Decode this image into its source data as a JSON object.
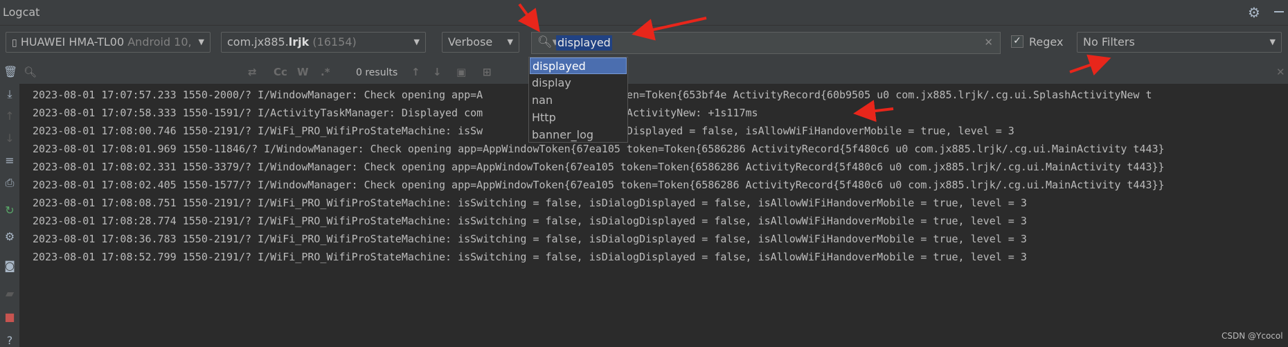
{
  "window": {
    "title": "Logcat"
  },
  "toolbar": {
    "device": {
      "name": "HUAWEI HMA-TL00",
      "version": "Android 10,"
    },
    "process": {
      "prefix": "com.jx885.",
      "bold": "lrjk",
      "pid": "(16154)"
    },
    "level": "Verbose",
    "search_value": "displayed",
    "regex": {
      "label": "Regex",
      "checked": true,
      "check_glyph": "✓"
    },
    "filter": "No Filters"
  },
  "secondary": {
    "results": "0 results",
    "cc_label": "Cc",
    "w_label": "W",
    "star_label": ".*"
  },
  "dropdown": {
    "items": [
      "displayed",
      "display",
      "nan",
      "Http",
      "banner_log"
    ],
    "selected_index": 0
  },
  "log_lines": [
    "2023-08-01 17:07:57.233 1550-2000/? I/WindowManager: Check opening app=A            638ae87 token=Token{653bf4e ActivityRecord{60b9505 u0 com.jx885.lrjk/.cg.ui.SplashActivityNew t",
    "2023-08-01 17:07:58.333 1550-1591/? I/ActivityTaskManager: Displayed com            g.ui.SplashActivityNew: +1s117ms",
    "2023-08-01 17:08:00.746 1550-2191/? I/WiFi_PRO_WifiProStateMachine: isSw            e, isDialogDisplayed = false, isAllowWiFiHandoverMobile = true, level = 3",
    "2023-08-01 17:08:01.969 1550-11846/? I/WindowManager: Check opening app=AppWindowToken{67ea105 token=Token{6586286 ActivityRecord{5f480c6 u0 com.jx885.lrjk/.cg.ui.MainActivity t443}",
    "2023-08-01 17:08:02.331 1550-3379/? I/WindowManager: Check opening app=AppWindowToken{67ea105 token=Token{6586286 ActivityRecord{5f480c6 u0 com.jx885.lrjk/.cg.ui.MainActivity t443}}",
    "2023-08-01 17:08:02.405 1550-1577/? I/WindowManager: Check opening app=AppWindowToken{67ea105 token=Token{6586286 ActivityRecord{5f480c6 u0 com.jx885.lrjk/.cg.ui.MainActivity t443}}",
    "2023-08-01 17:08:08.751 1550-2191/? I/WiFi_PRO_WifiProStateMachine: isSwitching = false, isDialogDisplayed = false, isAllowWiFiHandoverMobile = true, level = 3",
    "2023-08-01 17:08:28.774 1550-2191/? I/WiFi_PRO_WifiProStateMachine: isSwitching = false, isDialogDisplayed = false, isAllowWiFiHandoverMobile = true, level = 3",
    "2023-08-01 17:08:36.783 1550-2191/? I/WiFi_PRO_WifiProStateMachine: isSwitching = false, isDialogDisplayed = false, isAllowWiFiHandoverMobile = true, level = 3",
    "2023-08-01 17:08:52.799 1550-2191/? I/WiFi_PRO_WifiProStateMachine: isSwitching = false, isDialogDisplayed = false, isAllowWiFiHandoverMobile = true, level = 3"
  ],
  "watermark": "CSDN @Ycocol",
  "colors": {
    "annotation_arrow": "#e8261b",
    "selection": "#214283",
    "dropdown_selected": "#4b6eaf"
  },
  "icons": {
    "left_bar": [
      "trash-icon",
      "scroll-to-end-icon",
      "up-arrow-icon",
      "down-arrow-icon",
      "soft-wrap-icon",
      "print-icon",
      "restart-icon",
      "settings-icon",
      "screenshot-icon",
      "screen-record-icon",
      "stop-icon",
      "help-icon"
    ],
    "toolbar": [
      "phone-icon",
      "search-icon",
      "clear-icon",
      "gear-icon",
      "minimize-icon"
    ]
  }
}
